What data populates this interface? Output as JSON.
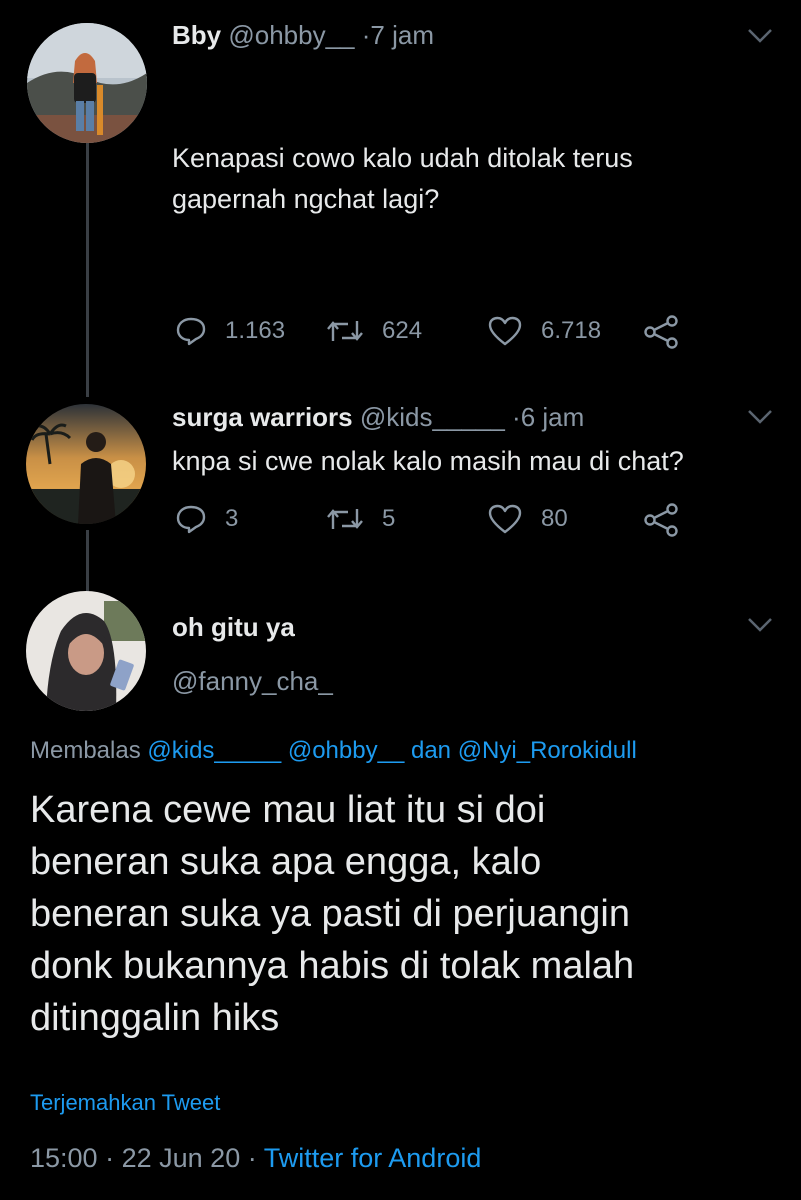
{
  "tweet1": {
    "name": "Bby",
    "handle": "@ohbby__",
    "separator": "·",
    "time": "7 jam",
    "text_line1": "Kenapasi cowo kalo udah ditolak terus",
    "text_line2": "gapernah ngchat lagi?",
    "replies": "1.163",
    "retweets": "624",
    "likes": "6.718"
  },
  "tweet2": {
    "name": "surga warriors",
    "handle": "@kids_____",
    "separator": "·",
    "time": "6 jam",
    "text": "knpa si cwe nolak kalo masih mau di chat?",
    "replies": "3",
    "retweets": "5",
    "likes": "80"
  },
  "main_tweet": {
    "name": "oh gitu ya",
    "handle": "@fanny_cha_",
    "reply_prefix": "Membalas",
    "mention1": "@kids_____",
    "mention2": "@ohbby__",
    "reply_and": "dan",
    "mention3": "@Nyi_Rorokidull",
    "text_lines": [
      "Karena cewe mau liat itu si doi",
      "beneran suka apa engga, kalo",
      "beneran suka ya pasti di perjuangin",
      "donk bukannya habis di tolak malah",
      "ditinggalin hiks"
    ],
    "translate_label": "Terjemahkan Tweet",
    "time": "15:00",
    "date": "22 Jun 20",
    "separator": "·",
    "source": "Twitter for Android"
  },
  "icons": {
    "reply": "reply-icon",
    "retweet": "retweet-icon",
    "like": "like-icon",
    "share": "share-icon",
    "menu": "chevron-down-icon"
  },
  "colors": {
    "background": "#000000",
    "text": "#e7e9ea",
    "muted": "#8b98a5",
    "accent": "#1d9bf0",
    "thread_line": "#3a3f45"
  }
}
